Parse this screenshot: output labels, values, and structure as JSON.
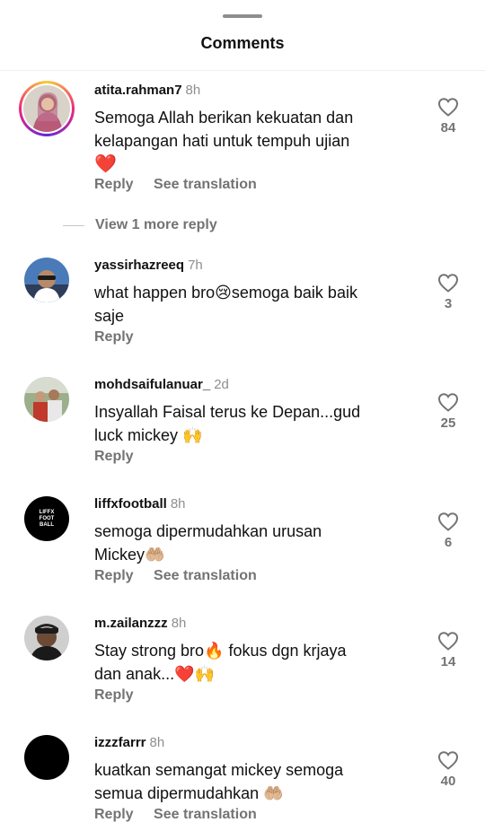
{
  "header": {
    "title": "Comments"
  },
  "actions": {
    "reply": "Reply",
    "see_translation": "See translation"
  },
  "view_more_reply": "View 1 more reply",
  "comments": [
    {
      "username": "atita.rahman7",
      "time": "8h",
      "text_line1": "Semoga Allah berikan kekuatan dan",
      "text_line2": "kelapangan hati untuk tempuh ujian",
      "text_line3": "❤️",
      "likes": "84"
    },
    {
      "username": "yassirhazreeq",
      "time": "7h",
      "text_line1": "what happen bro😢semoga baik baik",
      "text_line2": "saje",
      "likes": "3"
    },
    {
      "username": "mohdsaifulanuar_",
      "time": "2d",
      "text_line1": "Insyallah Faisal terus ke Depan...gud",
      "text_line2": "luck mickey 🙌",
      "likes": "25"
    },
    {
      "username": "liffxfootball",
      "time": "8h",
      "text_line1": "semoga dipermudahkan urusan",
      "text_line2": "Mickey🤲🏼",
      "likes": "6",
      "avatar_text": "LIFFX FOOT BALL"
    },
    {
      "username": "m.zailanzzz",
      "time": "8h",
      "text_line1": "Stay strong bro🔥 fokus dgn krjaya",
      "text_line2": "dan anak...❤️🙌",
      "likes": "14"
    },
    {
      "username": "izzzfarrr",
      "time": "8h",
      "text_line1": "kuatkan semangat mickey semoga",
      "text_line2": "semua dipermudahkan 🤲🏼",
      "likes": "40"
    }
  ]
}
